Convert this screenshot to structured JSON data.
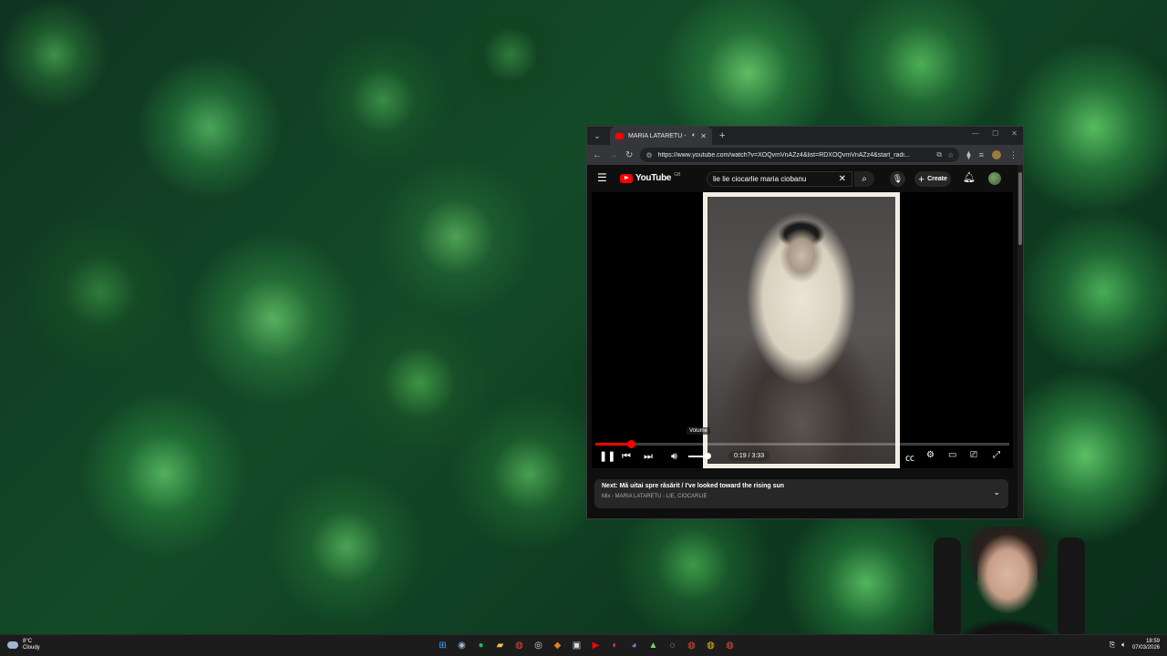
{
  "browser": {
    "tab_title": "MARIA LATARETU - LIE, CIC",
    "new_tab": "+",
    "url": "https://www.youtube.com/watch?v=XOQvmVnAZz4&list=RDXOQvmVnAZz4&start_radi..."
  },
  "youtube": {
    "logo_text": "YouTube",
    "logo_country": "GB",
    "search_query": "lie lie ciocarlie maria ciobanu",
    "create_label": "Create"
  },
  "player": {
    "progress_fraction": 0.085,
    "volume_fraction": 0.8,
    "volume_tooltip": "Volume",
    "time": "0:19 / 3:33"
  },
  "next_up": {
    "prefix": "Next:",
    "title": "Mă uitai spre răsărit / I've looked toward the rising sun",
    "subtitle": "Mix - MARIA LATARETU - LIE, CIOCARLIE"
  },
  "taskbar": {
    "weather_temp": "8°C",
    "weather_desc": "Cloudy",
    "time": "18:59",
    "date": "07/03/2026"
  },
  "colors": {
    "accent": "#ff0000",
    "player_bg": "#000000",
    "page_bg": "#0f0f0f"
  }
}
